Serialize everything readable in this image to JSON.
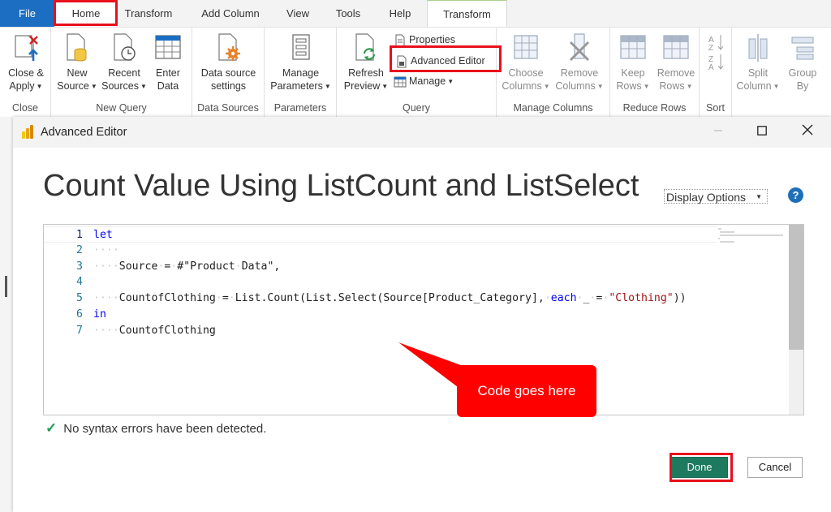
{
  "tabs": [
    "File",
    "Home",
    "Transform",
    "Add Column",
    "View",
    "Tools",
    "Help",
    "Transform"
  ],
  "ribbon": {
    "close_group": {
      "btn1": "Close &",
      "btn2": "Apply",
      "label": "Close"
    },
    "new_query_group": {
      "new_source": [
        "New",
        "Source"
      ],
      "recent_sources": [
        "Recent",
        "Sources"
      ],
      "enter_data": [
        "Enter",
        "Data"
      ],
      "label": "New Query"
    },
    "data_sources_group": {
      "btn": [
        "Data source",
        "settings"
      ],
      "label": "Data Sources"
    },
    "parameters_group": {
      "btn": [
        "Manage",
        "Parameters"
      ],
      "label": "Parameters"
    },
    "query_group": {
      "refresh": [
        "Refresh",
        "Preview"
      ],
      "properties": "Properties",
      "advanced_editor": "Advanced Editor",
      "manage": "Manage",
      "label": "Query"
    },
    "manage_columns_group": {
      "choose": [
        "Choose",
        "Columns"
      ],
      "remove": [
        "Remove",
        "Columns"
      ],
      "label": "Manage Columns"
    },
    "reduce_rows_group": {
      "keep": [
        "Keep",
        "Rows"
      ],
      "remove": [
        "Remove",
        "Rows"
      ],
      "label": "Reduce Rows"
    },
    "sort_group": {
      "label": "Sort"
    },
    "split_column": [
      "Split",
      "Column"
    ],
    "group_by": [
      "Group",
      "By"
    ]
  },
  "dialog": {
    "title": "Advanced Editor",
    "query_title": "Count Value Using ListCount and ListSelect",
    "display_options": "Display Options",
    "help": "?",
    "status": "No syntax errors have been detected.",
    "done": "Done",
    "cancel": "Cancel"
  },
  "editor_lines": [
    {
      "n": "1",
      "indent": "",
      "parts": [
        {
          "t": "let",
          "k": "kw"
        }
      ]
    },
    {
      "n": "2",
      "indent": "····",
      "parts": []
    },
    {
      "n": "3",
      "indent": "····",
      "parts": [
        {
          "t": "Source",
          "k": ""
        },
        {
          "t": "·",
          "k": "ws"
        },
        {
          "t": "=",
          "k": ""
        },
        {
          "t": "·",
          "k": "ws"
        },
        {
          "t": "#\"Product",
          "k": ""
        },
        {
          "t": "·",
          "k": "ws"
        },
        {
          "t": "Data\",",
          "k": ""
        }
      ]
    },
    {
      "n": "4",
      "indent": "",
      "parts": []
    },
    {
      "n": "5",
      "indent": "····",
      "parts": [
        {
          "t": "CountofClothing",
          "k": ""
        },
        {
          "t": "·",
          "k": "ws"
        },
        {
          "t": "=",
          "k": ""
        },
        {
          "t": "·",
          "k": "ws"
        },
        {
          "t": "List.Count(List.Select(Source[Product_Category],",
          "k": ""
        },
        {
          "t": "·",
          "k": "ws"
        },
        {
          "t": "each",
          "k": "kw"
        },
        {
          "t": "·",
          "k": "ws"
        },
        {
          "t": "_",
          "k": ""
        },
        {
          "t": "·",
          "k": "ws"
        },
        {
          "t": "=",
          "k": ""
        },
        {
          "t": "·",
          "k": "ws"
        },
        {
          "t": "\"Clothing\"",
          "k": "str"
        },
        {
          "t": "))",
          "k": ""
        }
      ]
    },
    {
      "n": "6",
      "indent": "",
      "parts": [
        {
          "t": "in",
          "k": "kw"
        }
      ]
    },
    {
      "n": "7",
      "indent": "····",
      "parts": [
        {
          "t": "CountofClothing",
          "k": ""
        }
      ]
    }
  ],
  "callout": "Code goes here",
  "colors": {
    "highlight": "#e8101c",
    "file_tab": "#1b6ec2",
    "done": "#1e7a5e",
    "callout": "#ff0000"
  }
}
